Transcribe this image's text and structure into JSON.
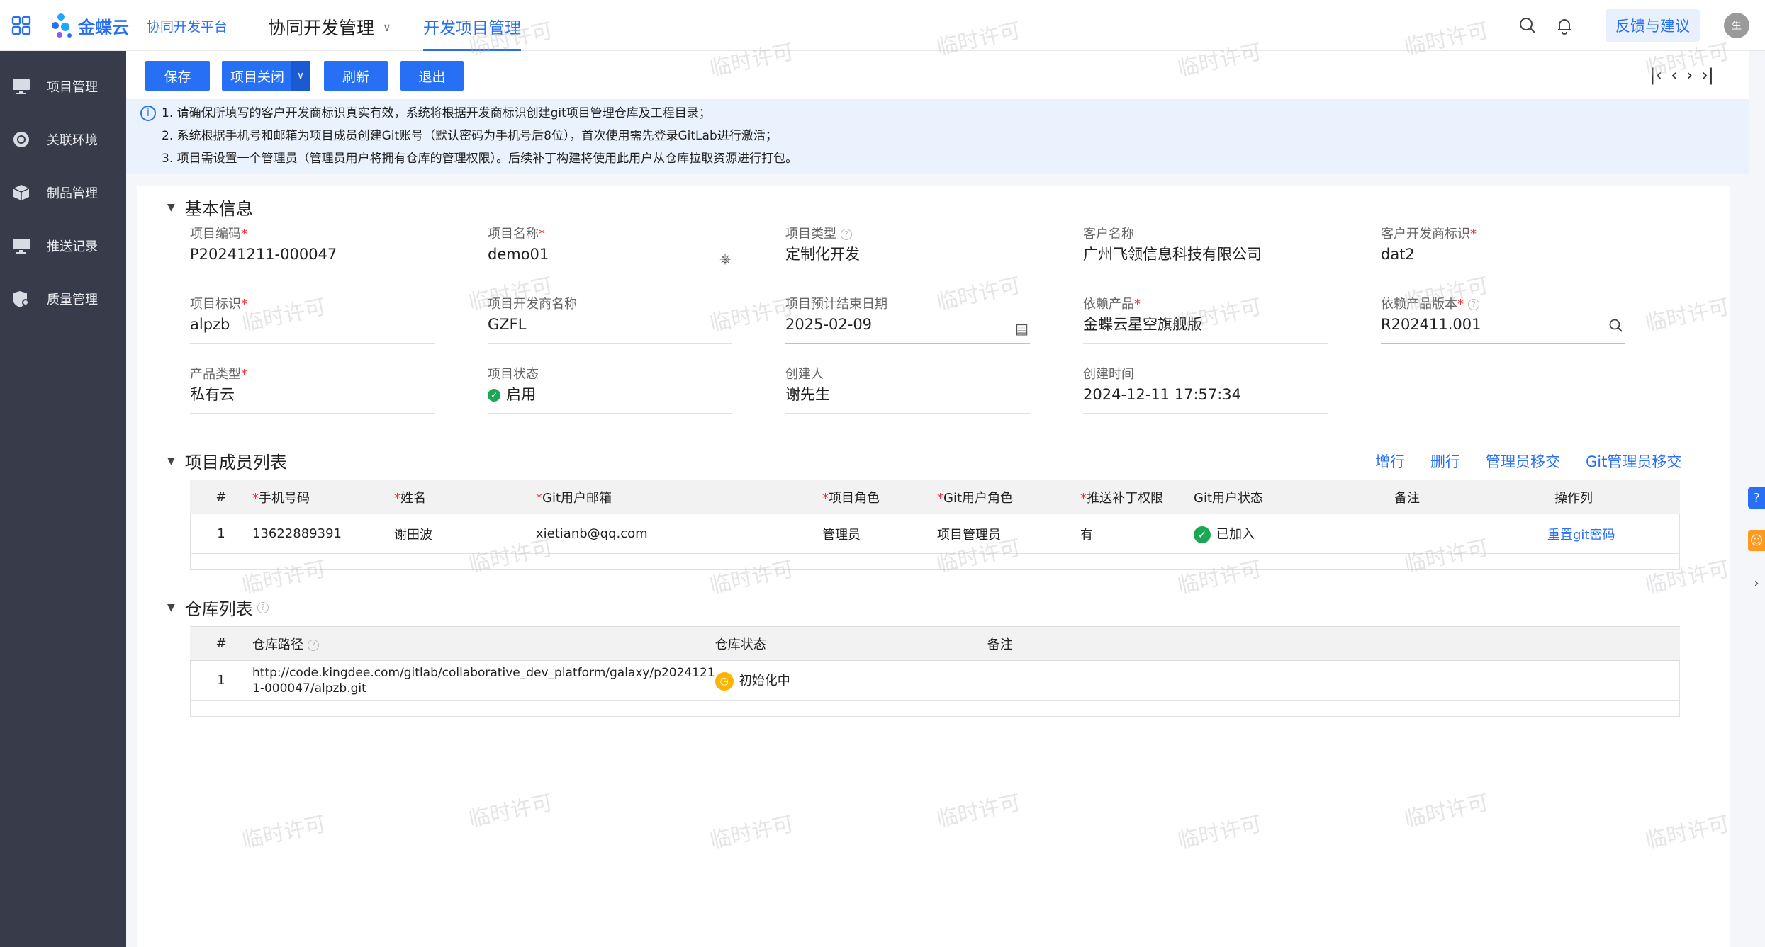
{
  "header": {
    "logo_text": "金蝶云",
    "platform": "协同开发平台",
    "menu": "协同开发管理",
    "active_tab": "开发项目管理",
    "feedback": "反馈与建议",
    "avatar": "生"
  },
  "sidebar": {
    "items": [
      {
        "label": "项目管理",
        "icon": "monitor-icon"
      },
      {
        "label": "关联环境",
        "icon": "ring-icon"
      },
      {
        "label": "制品管理",
        "icon": "cube-icon"
      },
      {
        "label": "推送记录",
        "icon": "monitor-icon"
      },
      {
        "label": "质量管理",
        "icon": "shield-icon"
      }
    ]
  },
  "toolbar": {
    "save": "保存",
    "close": "项目关闭",
    "refresh": "刷新",
    "exit": "退出"
  },
  "notice": {
    "line1": "1. 请确保所填写的客户开发商标识真实有效，系统将根据开发商标识创建git项目管理仓库及工程目录；",
    "line2": "2. 系统根据手机号和邮箱为项目成员创建Git账号（默认密码为手机号后8位），首次使用需先登录GitLab进行激活；",
    "line3": "3. 项目需设置一个管理员（管理员用户将拥有仓库的管理权限）。后续补丁构建将使用此用户从仓库拉取资源进行打包。"
  },
  "basic": {
    "title": "基本信息",
    "fields": {
      "code": {
        "label": "项目编码",
        "value": "P20241211-000047"
      },
      "name": {
        "label": "项目名称",
        "value": "demo01"
      },
      "type": {
        "label": "项目类型",
        "value": "定制化开发"
      },
      "customer": {
        "label": "客户名称",
        "value": "广州飞领信息科技有限公司"
      },
      "dev_id": {
        "label": "客户开发商标识",
        "value": "dat2"
      },
      "ident": {
        "label": "项目标识",
        "value": "alpzb"
      },
      "dev_name": {
        "label": "项目开发商名称",
        "value": "GZFL"
      },
      "end_date": {
        "label": "项目预计结束日期",
        "value": "2025-02-09"
      },
      "product": {
        "label": "依赖产品",
        "value": "金蝶云星空旗舰版"
      },
      "product_ver": {
        "label": "依赖产品版本",
        "value": "R202411.001"
      },
      "prod_type": {
        "label": "产品类型",
        "value": "私有云"
      },
      "status": {
        "label": "项目状态",
        "value": "启用"
      },
      "creator": {
        "label": "创建人",
        "value": "谢先生"
      },
      "created": {
        "label": "创建时间",
        "value": "2024-12-11 17:57:34"
      }
    }
  },
  "members": {
    "title": "项目成员列表",
    "actions": {
      "add": "增行",
      "del": "删行",
      "admin": "管理员移交",
      "git_admin": "Git管理员移交"
    },
    "headers": {
      "idx": "#",
      "phone": "手机号码",
      "name": "姓名",
      "email": "Git用户邮箱",
      "role": "项目角色",
      "git_role": "Git用户角色",
      "perm": "推送补丁权限",
      "git_status": "Git用户状态",
      "note": "备注",
      "ops": "操作列"
    },
    "rows": [
      {
        "idx": "1",
        "phone": "13622889391",
        "name": "谢田波",
        "email": "xietianb@qq.com",
        "role": "管理员",
        "git_role": "项目管理员",
        "perm": "有",
        "git_status": "已加入",
        "note": "",
        "op": "重置git密码"
      }
    ]
  },
  "repos": {
    "title": "仓库列表",
    "headers": {
      "idx": "#",
      "path": "仓库路径",
      "status": "仓库状态",
      "note": "备注"
    },
    "rows": [
      {
        "idx": "1",
        "path_l1": "http://code.kingdee.com/gitlab/collaborative_dev_platform/galaxy/p2024121",
        "path_l2": "1-000047/alpzb.git",
        "status": "初始化中",
        "note": ""
      }
    ]
  },
  "watermark": "临时许可",
  "colors": {
    "primary": "#276ff5",
    "sidebar": "#383c4a",
    "required": "#f1343c",
    "success": "#1ba854",
    "warning": "#ffb400"
  }
}
